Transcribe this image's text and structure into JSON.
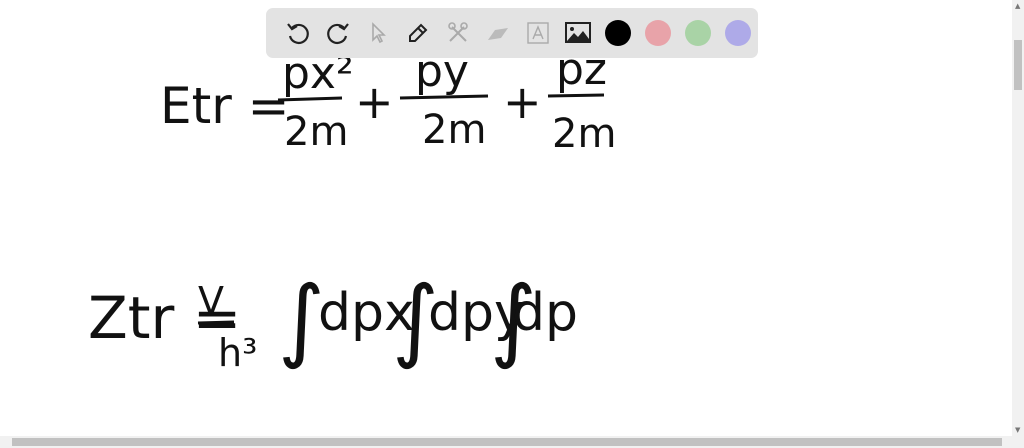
{
  "toolbar": {
    "tools": [
      "undo-icon",
      "redo-icon",
      "select-icon",
      "pen-icon",
      "tools-icon",
      "eraser-icon",
      "text-icon",
      "image-icon"
    ],
    "colors": [
      "#000000",
      "#e8a3a9",
      "#a9d3a6",
      "#aeaae8"
    ]
  },
  "whiteboard": {
    "eq1": {
      "lhs": "Etr =",
      "n1": "px²",
      "d1": "2m",
      "plus": "+",
      "n2": "py",
      "d2": "2m",
      "n3": "pz",
      "d3": "2m"
    },
    "eq2": {
      "lhs": "Ztr =",
      "num": "V",
      "den": "h³",
      "int1": "∫",
      "t1": "dpx",
      "int2": "∫",
      "t2": "dpy",
      "int3": "∫",
      "t3": "dp"
    }
  }
}
